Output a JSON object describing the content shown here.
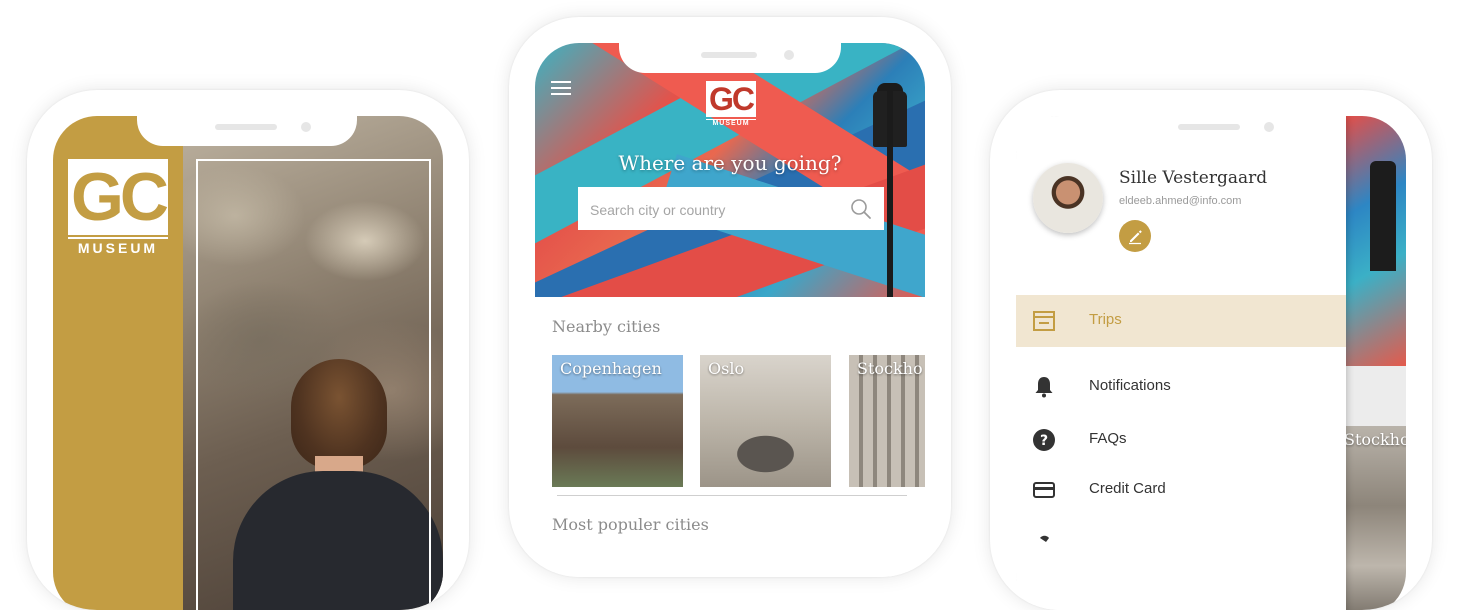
{
  "phone_splash": {
    "logo_letters": "GC",
    "logo_subtitle": "MUSEUM"
  },
  "phone_home": {
    "logo_letters": "GC",
    "logo_subtitle": "MUSEUM",
    "headline": "Where are you going?",
    "search": {
      "placeholder": "Search city or country",
      "value": ""
    },
    "nearby_title": "Nearby cities",
    "nearby_cities": [
      {
        "name": "Copenhagen"
      },
      {
        "name": "Oslo"
      },
      {
        "name": "Stockho"
      }
    ],
    "popular_title": "Most populer cities",
    "icons": {
      "menu": "hamburger-menu-icon",
      "search": "magnifier-icon"
    }
  },
  "phone_menu": {
    "user": {
      "name": "Sille Vestergaard",
      "email": "eldeeb.ahmed@info.com"
    },
    "menu_items": [
      {
        "label": "Trips",
        "icon": "trips-icon",
        "active": true
      },
      {
        "label": "Notifications",
        "icon": "bell-icon",
        "active": false
      },
      {
        "label": "FAQs",
        "icon": "help-circle-icon",
        "active": false
      },
      {
        "label": "Credit Card",
        "icon": "credit-card-icon",
        "active": false
      }
    ],
    "peek_city": "Stockho"
  },
  "colors": {
    "brand_gold": "#c39d43",
    "active_row_bg": "#f1e6d1",
    "logo_red": "#c0392b"
  }
}
